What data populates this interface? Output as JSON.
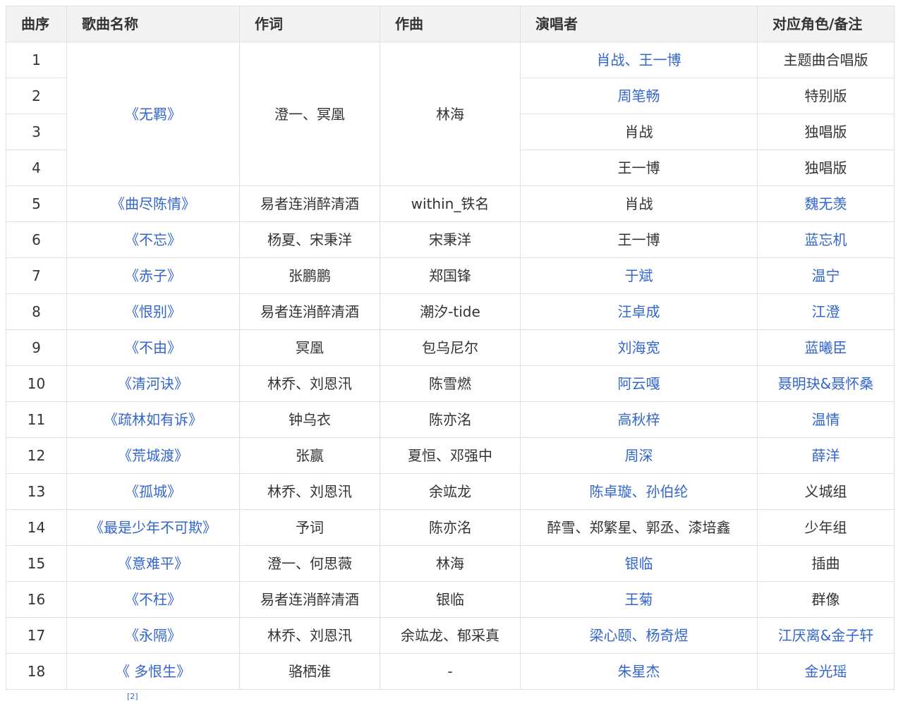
{
  "table": {
    "headers": [
      "曲序",
      "歌曲名称",
      "作词",
      "作曲",
      "演唱者",
      "对应角色/备注"
    ],
    "rows": [
      {
        "no": "1",
        "song": "《无羁》",
        "lyricist": "澄一、冥凰",
        "composer": "林海",
        "singer": "肖战、王一博",
        "note": "主题曲合唱版"
      },
      {
        "no": "2",
        "singer": "周笔畅",
        "note": "特别版"
      },
      {
        "no": "3",
        "singer": "肖战",
        "note": "独唱版"
      },
      {
        "no": "4",
        "singer": "王一博",
        "note": "独唱版"
      },
      {
        "no": "5",
        "song": "《曲尽陈情》",
        "lyricist": "易者连消醉清酒",
        "composer": "within_铁名",
        "singer": "肖战",
        "note": "魏无羡"
      },
      {
        "no": "6",
        "song": "《不忘》",
        "lyricist": "杨夏、宋秉洋",
        "composer": "宋秉洋",
        "singer": "王一博",
        "note": "蓝忘机"
      },
      {
        "no": "7",
        "song": "《赤子》",
        "lyricist": "张鹏鹏",
        "composer": "郑国锋",
        "singer": "于斌",
        "note": "温宁"
      },
      {
        "no": "8",
        "song": "《恨别》",
        "lyricist": "易者连消醉清酒",
        "composer": "潮汐-tide",
        "singer": "汪卓成",
        "note": "江澄"
      },
      {
        "no": "9",
        "song": "《不由》",
        "lyricist": "冥凰",
        "composer": "包乌尼尔",
        "singer": "刘海宽",
        "note": "蓝曦臣"
      },
      {
        "no": "10",
        "song": "《清河诀》",
        "lyricist": "林乔、刘恩汛",
        "composer": "陈雪燃",
        "singer": "阿云嘎",
        "note": "聂明玦&聂怀桑"
      },
      {
        "no": "11",
        "song": "《疏林如有诉》",
        "lyricist": "钟乌衣",
        "composer": "陈亦洺",
        "singer": "高秋梓",
        "note": "温情"
      },
      {
        "no": "12",
        "song": "《荒城渡》",
        "lyricist": "张赢",
        "composer": "夏恒、邓强中",
        "singer": "周深",
        "note": "薛洋"
      },
      {
        "no": "13",
        "song": "《孤城》",
        "lyricist": "林乔、刘恩汛",
        "composer": "余竑龙",
        "singer": "陈卓璇、孙伯纶",
        "note": "义城组"
      },
      {
        "no": "14",
        "song": "《最是少年不可欺》",
        "lyricist": "予词",
        "composer": "陈亦洺",
        "singer": "醉雪、郑繁星、郭丞、漆培鑫",
        "note": "少年组"
      },
      {
        "no": "15",
        "song": "《意难平》",
        "lyricist": "澄一、何思薇",
        "composer": "林海",
        "singer": "银临",
        "note": "插曲"
      },
      {
        "no": "16",
        "song": "《不枉》",
        "lyricist": "易者连消醉清酒",
        "composer": "银临",
        "singer": "王菊",
        "note": "群像"
      },
      {
        "no": "17",
        "song": "《永隔》",
        "lyricist": "林乔、刘恩汛",
        "composer": "余竑龙、郁采真",
        "singer": "梁心颐、杨奇煜",
        "note": "江厌离&金子轩"
      },
      {
        "no": "18",
        "song": "《 多恨生》",
        "lyricist": "骆栖淮",
        "composer": "-",
        "singer": "朱星杰",
        "note": "金光瑶"
      }
    ]
  },
  "footnote": "[2]",
  "colors": {
    "link": "#3366cc",
    "header_bg": "#f2f2f2",
    "border": "#e0e0e0",
    "text": "#333333"
  }
}
